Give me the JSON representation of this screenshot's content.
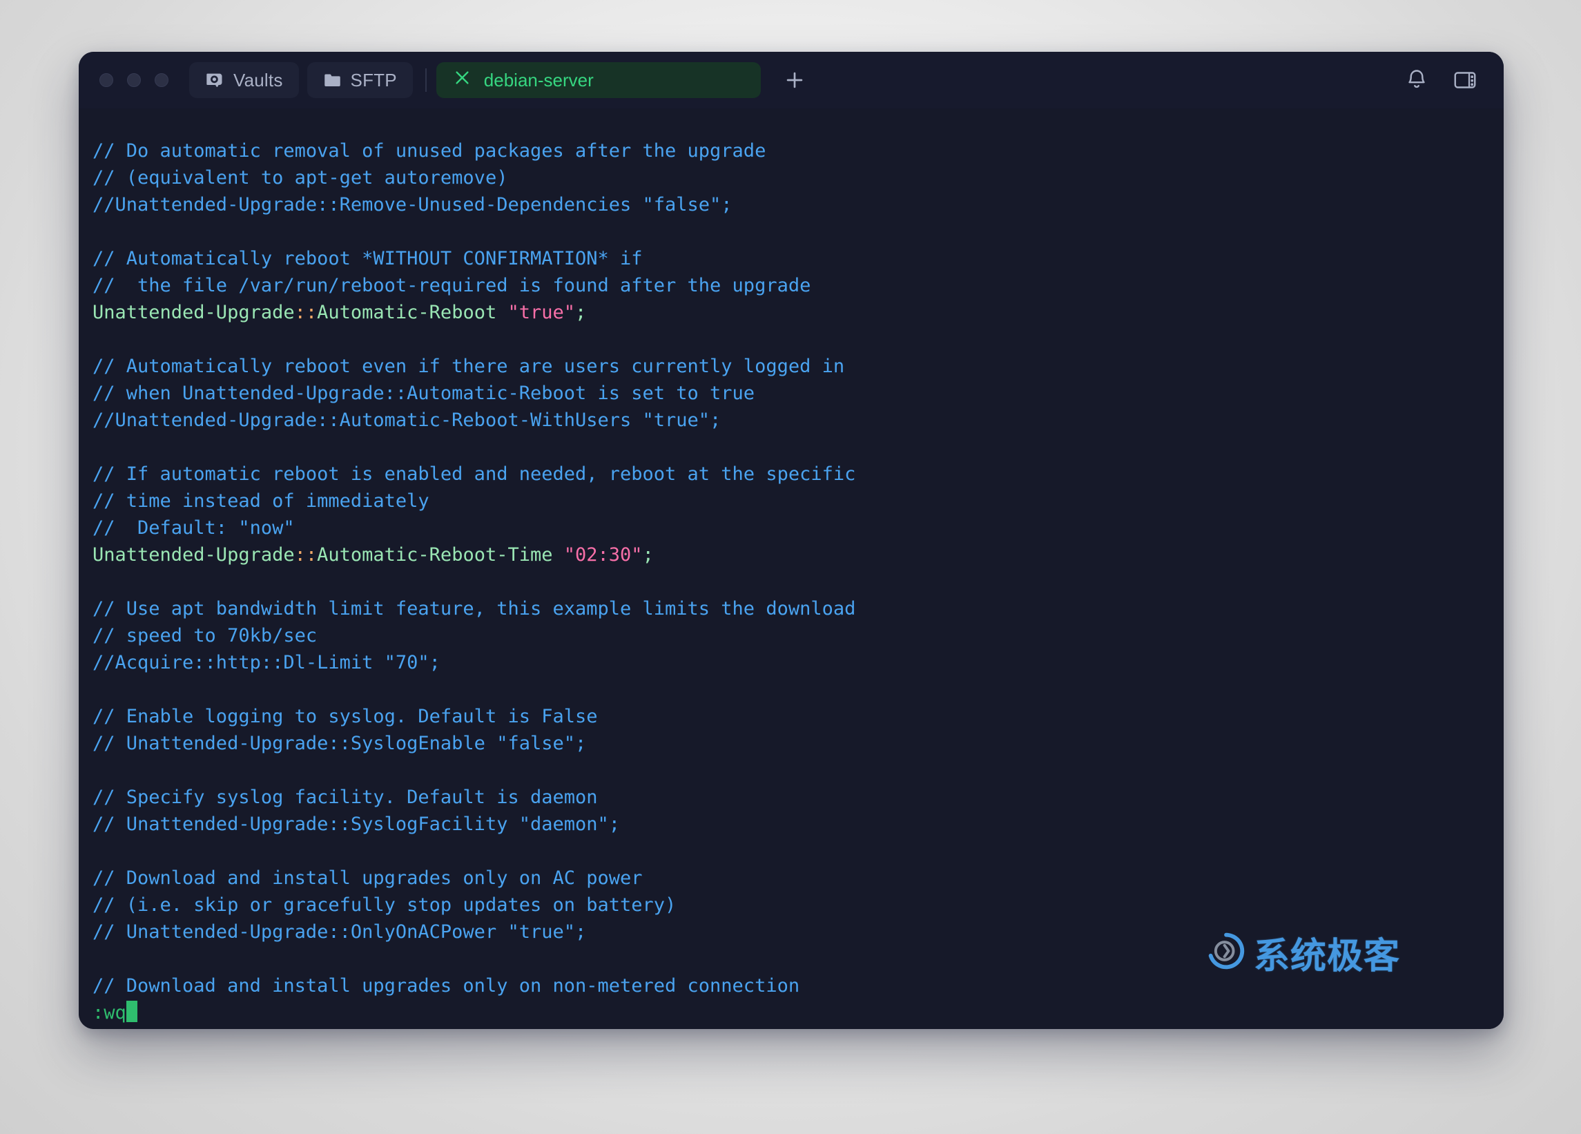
{
  "window": {
    "traffic_lights": [
      "close",
      "minimize",
      "maximize"
    ]
  },
  "titlebar": {
    "vaults_label": "Vaults",
    "sftp_label": "SFTP",
    "active_tab_label": "debian-server",
    "new_tab_label": "+",
    "icons": {
      "vault": "vault-icon",
      "folder": "folder-icon",
      "close_tab": "close-icon",
      "bell": "bell-icon",
      "panel": "panel-layout-icon"
    }
  },
  "colors": {
    "window_bg": "#171a2d",
    "terminal_bg": "#161929",
    "comment": "#4aa3f0",
    "key": "#9ae6b4",
    "operator": "#f0a868",
    "string": "#f76fa8",
    "tab_active_bg": "#173326",
    "tab_active_fg": "#36d680",
    "cursor": "#2fbd6e",
    "watermark": "#4aa3f0"
  },
  "terminal": {
    "lines": [
      {
        "type": "comment",
        "text": "// Do automatic removal of unused packages after the upgrade"
      },
      {
        "type": "comment",
        "text": "// (equivalent to apt-get autoremove)"
      },
      {
        "type": "comment",
        "text": "//Unattended-Upgrade::Remove-Unused-Dependencies \"false\";"
      },
      {
        "type": "blank",
        "text": ""
      },
      {
        "type": "comment",
        "text": "// Automatically reboot *WITHOUT CONFIRMATION* if"
      },
      {
        "type": "comment",
        "text": "//  the file /var/run/reboot-required is found after the upgrade"
      },
      {
        "type": "directive",
        "key": "Unattended-Upgrade",
        "op": "::",
        "name": "Automatic-Reboot",
        "value": "\"true\"",
        "end": ";"
      },
      {
        "type": "blank",
        "text": ""
      },
      {
        "type": "comment",
        "text": "// Automatically reboot even if there are users currently logged in"
      },
      {
        "type": "comment",
        "text": "// when Unattended-Upgrade::Automatic-Reboot is set to true"
      },
      {
        "type": "comment",
        "text": "//Unattended-Upgrade::Automatic-Reboot-WithUsers \"true\";"
      },
      {
        "type": "blank",
        "text": ""
      },
      {
        "type": "comment",
        "text": "// If automatic reboot is enabled and needed, reboot at the specific"
      },
      {
        "type": "comment",
        "text": "// time instead of immediately"
      },
      {
        "type": "comment",
        "text": "//  Default: \"now\""
      },
      {
        "type": "directive",
        "key": "Unattended-Upgrade",
        "op": "::",
        "name": "Automatic-Reboot-Time",
        "value": "\"02:30\"",
        "end": ";"
      },
      {
        "type": "blank",
        "text": ""
      },
      {
        "type": "comment",
        "text": "// Use apt bandwidth limit feature, this example limits the download"
      },
      {
        "type": "comment",
        "text": "// speed to 70kb/sec"
      },
      {
        "type": "comment",
        "text": "//Acquire::http::Dl-Limit \"70\";"
      },
      {
        "type": "blank",
        "text": ""
      },
      {
        "type": "comment",
        "text": "// Enable logging to syslog. Default is False"
      },
      {
        "type": "comment",
        "text": "// Unattended-Upgrade::SyslogEnable \"false\";"
      },
      {
        "type": "blank",
        "text": ""
      },
      {
        "type": "comment",
        "text": "// Specify syslog facility. Default is daemon"
      },
      {
        "type": "comment",
        "text": "// Unattended-Upgrade::SyslogFacility \"daemon\";"
      },
      {
        "type": "blank",
        "text": ""
      },
      {
        "type": "comment",
        "text": "// Download and install upgrades only on AC power"
      },
      {
        "type": "comment",
        "text": "// (i.e. skip or gracefully stop updates on battery)"
      },
      {
        "type": "comment",
        "text": "// Unattended-Upgrade::OnlyOnACPower \"true\";"
      },
      {
        "type": "blank",
        "text": ""
      },
      {
        "type": "comment",
        "text": "// Download and install upgrades only on non-metered connection"
      },
      {
        "type": "command",
        "text": ":wq"
      }
    ]
  },
  "watermark": {
    "text": "系统极客"
  }
}
